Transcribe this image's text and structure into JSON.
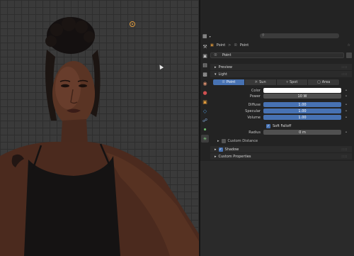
{
  "header": {
    "editor_icon": "properties-editor-icon",
    "search_placeholder": ""
  },
  "breadcrumb": {
    "object": "Point",
    "separator": ">",
    "data": "Point"
  },
  "datablock": {
    "name": "Point"
  },
  "panels": {
    "preview": "Preview",
    "light": "Light",
    "custom_distance": "Custom Distance",
    "shadow": "Shadow",
    "custom_properties": "Custom Properties"
  },
  "light_types": [
    {
      "label": "Point",
      "icon": "point-light-icon",
      "active": true
    },
    {
      "label": "Sun",
      "icon": "sun-light-icon",
      "active": false
    },
    {
      "label": "Spot",
      "icon": "spot-light-icon",
      "active": false
    },
    {
      "label": "Area",
      "icon": "area-light-icon",
      "active": false
    }
  ],
  "properties": {
    "color_label": "Color",
    "color_value": "#ffffff",
    "power_label": "Power",
    "power_value": "10 W",
    "diffuse_label": "Diffuse",
    "diffuse_value": "1.00",
    "specular_label": "Specular",
    "specular_value": "1.00",
    "volume_label": "Volume",
    "volume_value": "1.00",
    "soft_falloff_label": "Soft Falloff",
    "soft_falloff_checked": true,
    "radius_label": "Radius",
    "radius_value": "0 m",
    "shadow_checked": true,
    "custom_distance_checked": false
  },
  "colors": {
    "accent": "#4772b3",
    "light_gizmo": "#e09a3c",
    "panel_bg": "#232323"
  }
}
